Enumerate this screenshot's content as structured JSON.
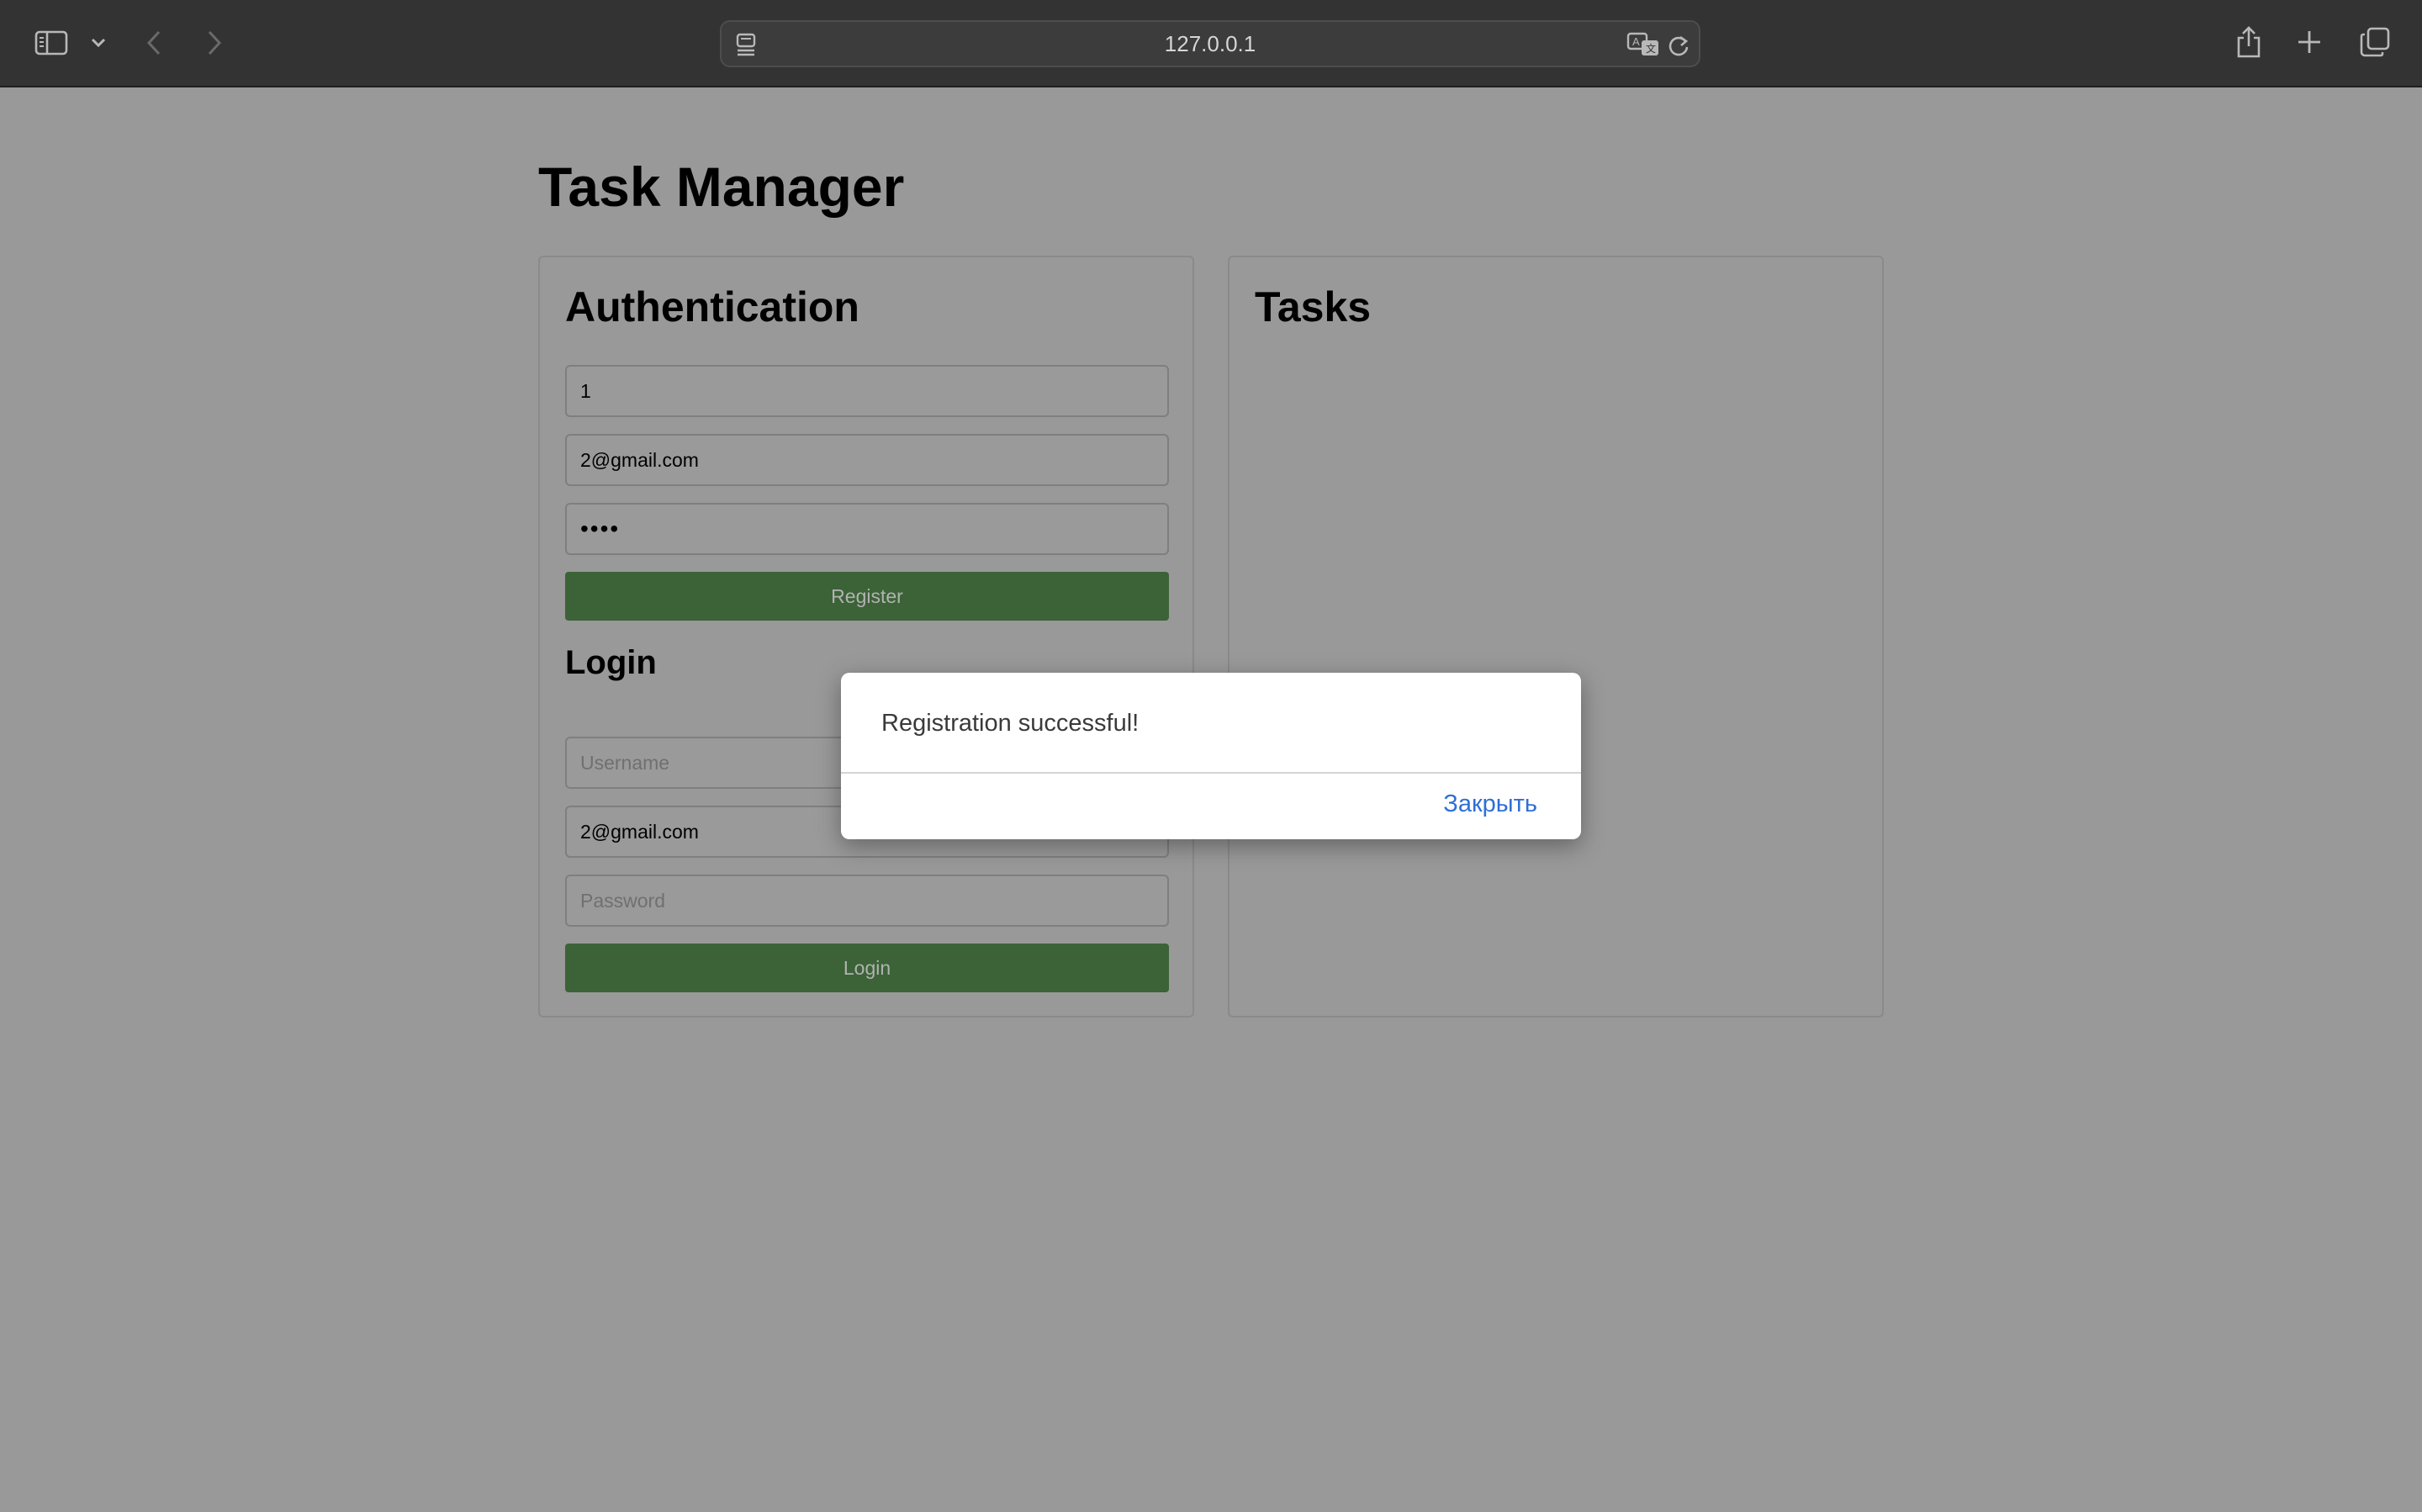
{
  "browser": {
    "url": "127.0.0.1",
    "icons": {
      "sidebar": "sidebar-icon",
      "chevron": "chevron-down-icon",
      "back": "back-arrow-icon",
      "forward": "forward-arrow-icon",
      "page_menu": "page-menu-icon",
      "translate": "translate-icon",
      "reload": "reload-icon",
      "share": "share-icon",
      "new_tab": "plus-icon",
      "tabs": "tab-overview-icon"
    }
  },
  "page": {
    "title": "Task Manager",
    "auth": {
      "heading": "Authentication",
      "register": {
        "username_value": "1",
        "email_value": "2@gmail.com",
        "password_value": "••••",
        "button_label": "Register"
      },
      "login": {
        "heading": "Login",
        "username_placeholder": "Username",
        "email_value": "2@gmail.com",
        "password_placeholder": "Password",
        "button_label": "Login"
      }
    },
    "tasks": {
      "heading": "Tasks"
    }
  },
  "dialog": {
    "message": "Registration successful!",
    "close_label": "Закрыть"
  },
  "colors": {
    "overlay_background": "#999999",
    "button_green": "#3b6337",
    "dialog_link": "#2f6fd6"
  }
}
